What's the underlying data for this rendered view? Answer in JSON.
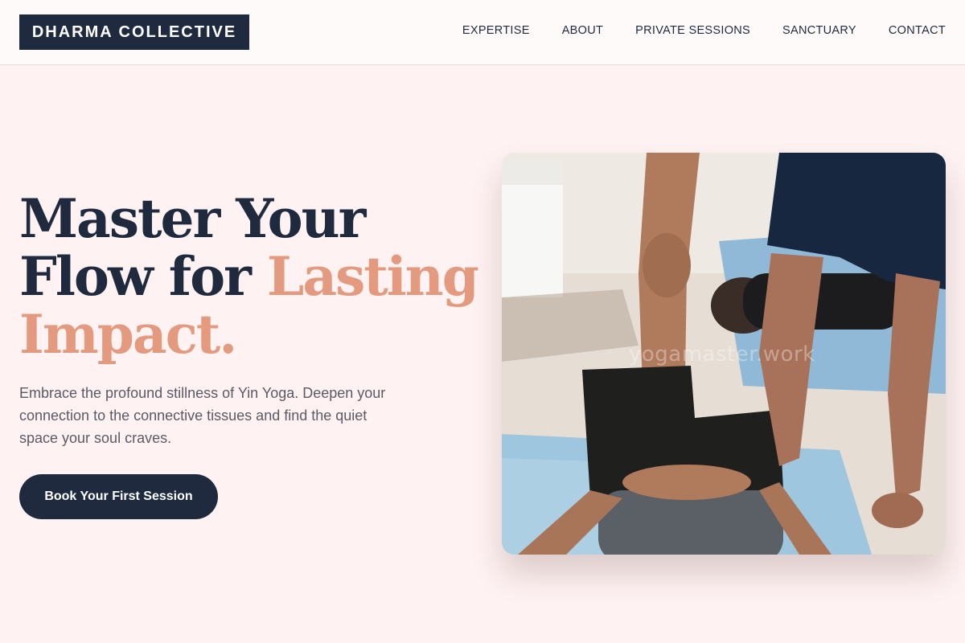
{
  "header": {
    "logo": "DHARMA COLLECTIVE",
    "nav": [
      "EXPERTISE",
      "ABOUT",
      "PRIVATE SESSIONS",
      "SANCTUARY",
      "CONTACT"
    ]
  },
  "hero": {
    "headline_part1": "Master Your Flow for ",
    "headline_accent": "Lasting Impact.",
    "subtext": "Embrace the profound stillness of Yin Yoga. Deepen your connection to the connective tissues and find the quiet space your soul craves.",
    "cta_label": "Book Your First Session",
    "image_watermark": "yogamaster.work"
  },
  "colors": {
    "page_background": "#fff2f2",
    "navy": "#1f2a3f",
    "accent": "#e39a7e",
    "body_text": "#5a5a66"
  }
}
